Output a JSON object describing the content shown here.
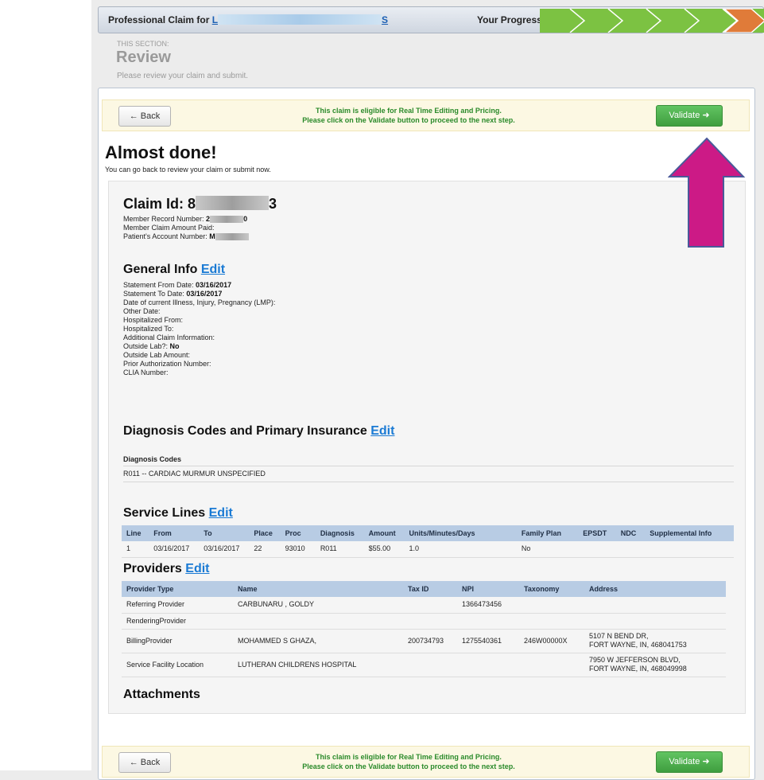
{
  "header": {
    "title_prefix": "Professional Claim for ",
    "title_link_start": "L",
    "title_link_end": "S",
    "progress_label": "Your Progress"
  },
  "section": {
    "label": "THIS SECTION:",
    "title": "Review",
    "description": "Please review your claim and submit."
  },
  "action_bar": {
    "back_label": "Back",
    "message_line1": "This claim is eligible for Real Time Editing and Pricing.",
    "message_line2": "Please click on the Validate button to proceed to the next step.",
    "validate_label": "Validate"
  },
  "intro": {
    "heading": "Almost done!",
    "subtext": "You can go back to review your claim or submit now."
  },
  "claim": {
    "id_label": "Claim Id: ",
    "id_start": "8",
    "id_end": "3",
    "member_record_label": "Member Record Number: ",
    "member_record_start": "2",
    "member_record_end": "0",
    "member_amount_label": "Member Claim Amount Paid:",
    "patient_account_label": "Patient's Account Number: ",
    "patient_account_start": "M"
  },
  "general_info": {
    "heading": "General Info",
    "edit": "Edit",
    "fields": [
      {
        "label": "Statement From Date: ",
        "value": "03/16/2017"
      },
      {
        "label": "Statement To Date: ",
        "value": "03/16/2017"
      },
      {
        "label": "Date of current Illness, Injury, Pregnancy (LMP):",
        "value": ""
      },
      {
        "label": "Other Date:",
        "value": ""
      },
      {
        "label": "Hospitalized From:",
        "value": ""
      },
      {
        "label": "Hospitalized To:",
        "value": ""
      },
      {
        "label": "Additional Claim Information:",
        "value": ""
      },
      {
        "label": "Outside Lab?: ",
        "value": "No"
      },
      {
        "label": "Outside Lab Amount:",
        "value": ""
      },
      {
        "label": "Prior Authorization Number:",
        "value": ""
      },
      {
        "label": "CLIA Number:",
        "value": ""
      }
    ]
  },
  "diagnosis": {
    "heading": "Diagnosis Codes and Primary Insurance",
    "edit": "Edit",
    "subheading": "Diagnosis Codes",
    "codes": [
      "R011 -- CARDIAC MURMUR UNSPECIFIED"
    ]
  },
  "service_lines": {
    "heading": "Service Lines",
    "edit": "Edit",
    "columns": [
      "Line",
      "From",
      "To",
      "Place",
      "Proc",
      "Diagnosis",
      "Amount",
      "Units/Minutes/Days",
      "Family Plan",
      "EPSDT",
      "NDC",
      "Supplemental Info"
    ],
    "rows": [
      [
        "1",
        "03/16/2017",
        "03/16/2017",
        "22",
        "93010",
        "R011",
        "$55.00",
        "1.0",
        "No",
        "",
        "",
        ""
      ]
    ]
  },
  "providers": {
    "heading": "Providers",
    "edit": "Edit",
    "columns": [
      "Provider Type",
      "Name",
      "Tax ID",
      "NPI",
      "Taxonomy",
      "Address"
    ],
    "rows": [
      {
        "type": "Referring Provider",
        "name": "CARBUNARU , GOLDY",
        "tax_id": "",
        "npi": "1366473456",
        "taxonomy": "",
        "address1": "",
        "address2": ""
      },
      {
        "type": "RenderingProvider",
        "name": "",
        "tax_id": "",
        "npi": "",
        "taxonomy": "",
        "address1": "",
        "address2": ""
      },
      {
        "type": "BillingProvider",
        "name": "MOHAMMED S GHAZA,",
        "tax_id": "200734793",
        "npi": "1275540361",
        "taxonomy": "246W00000X",
        "address1": "5107 N BEND DR,",
        "address2": "FORT WAYNE, IN, 468041753"
      },
      {
        "type": "Service Facility Location",
        "name": "LUTHERAN CHILDRENS HOSPITAL",
        "tax_id": "",
        "npi": "",
        "taxonomy": "",
        "address1": "7950 W JEFFERSON BLVD,",
        "address2": "FORT WAYNE, IN, 468049998"
      }
    ]
  },
  "attachments": {
    "heading": "Attachments"
  },
  "colors": {
    "accent_green": "#4cae4c",
    "progress_done": "#7cc242",
    "progress_current": "#e07b39",
    "annotation_arrow": "#cc1a86",
    "edit_link": "#1a7ad4"
  }
}
